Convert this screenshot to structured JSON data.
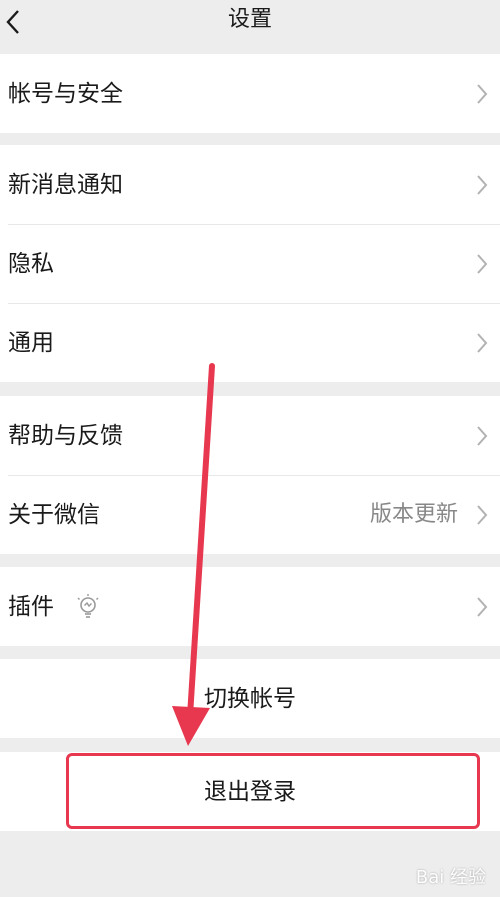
{
  "header": {
    "title": "设置",
    "back_icon": "chevron-left-icon"
  },
  "groups": {
    "account": {
      "items": [
        {
          "label": "帐号与安全"
        }
      ]
    },
    "general": {
      "items": [
        {
          "label": "新消息通知"
        },
        {
          "label": "隐私"
        },
        {
          "label": "通用"
        }
      ]
    },
    "support": {
      "items": [
        {
          "label": "帮助与反馈"
        },
        {
          "label": "关于微信",
          "value": "版本更新"
        }
      ]
    },
    "plugins": {
      "items": [
        {
          "label": "插件",
          "icon": "plugin-bulb-icon"
        }
      ]
    }
  },
  "actions": {
    "switch_account": "切换帐号",
    "logout": "退出登录"
  },
  "annotation": {
    "highlight_color": "#e8384f"
  },
  "watermark": {
    "text": "Bai 经验"
  }
}
